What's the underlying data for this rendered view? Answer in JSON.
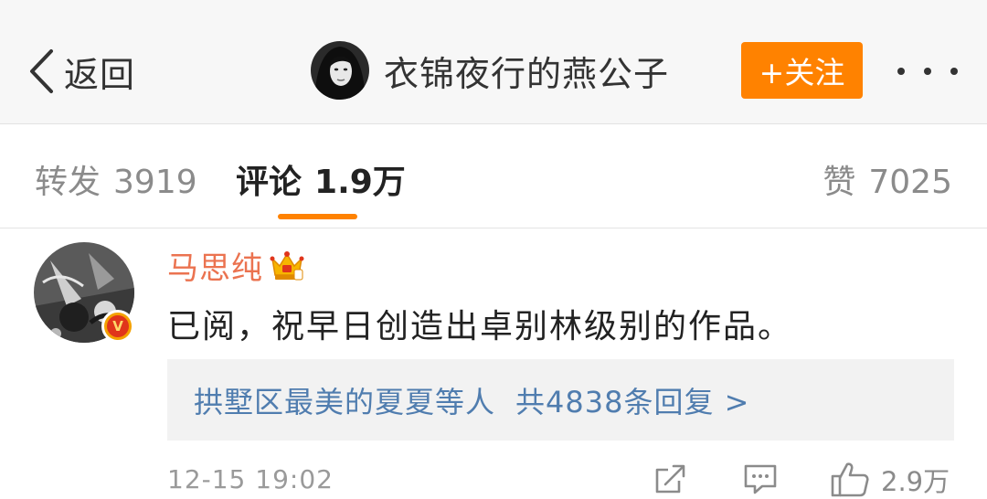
{
  "nav": {
    "back_label": "返回",
    "title": "衣锦夜行的燕公子",
    "follow_label": "+关注"
  },
  "tabs": {
    "repost": {
      "label": "转发",
      "count": "3919"
    },
    "comment": {
      "label": "评论",
      "count": "1.9万"
    },
    "like": {
      "label": "赞",
      "count": "7025"
    }
  },
  "comment": {
    "username": "马思纯",
    "text": "已阅，祝早日创造出卓别林级别的作品。",
    "reply_preview": {
      "who": "拱墅区最美的夏夏等人",
      "count_label": "共4838条回复 >"
    },
    "time": "12-15 19:02",
    "like_count": "2.9万"
  },
  "colors": {
    "accent": "#ff8200",
    "username": "#eb7350",
    "link": "#507daf",
    "muted": "#8b8b8b"
  },
  "icons": {
    "back": "chevron-left-icon",
    "more": "more-dots-icon",
    "crown": "crown-icon",
    "verified": "verified-v-icon",
    "repost": "repost-icon",
    "comment": "comment-icon",
    "like": "thumbs-up-icon"
  }
}
